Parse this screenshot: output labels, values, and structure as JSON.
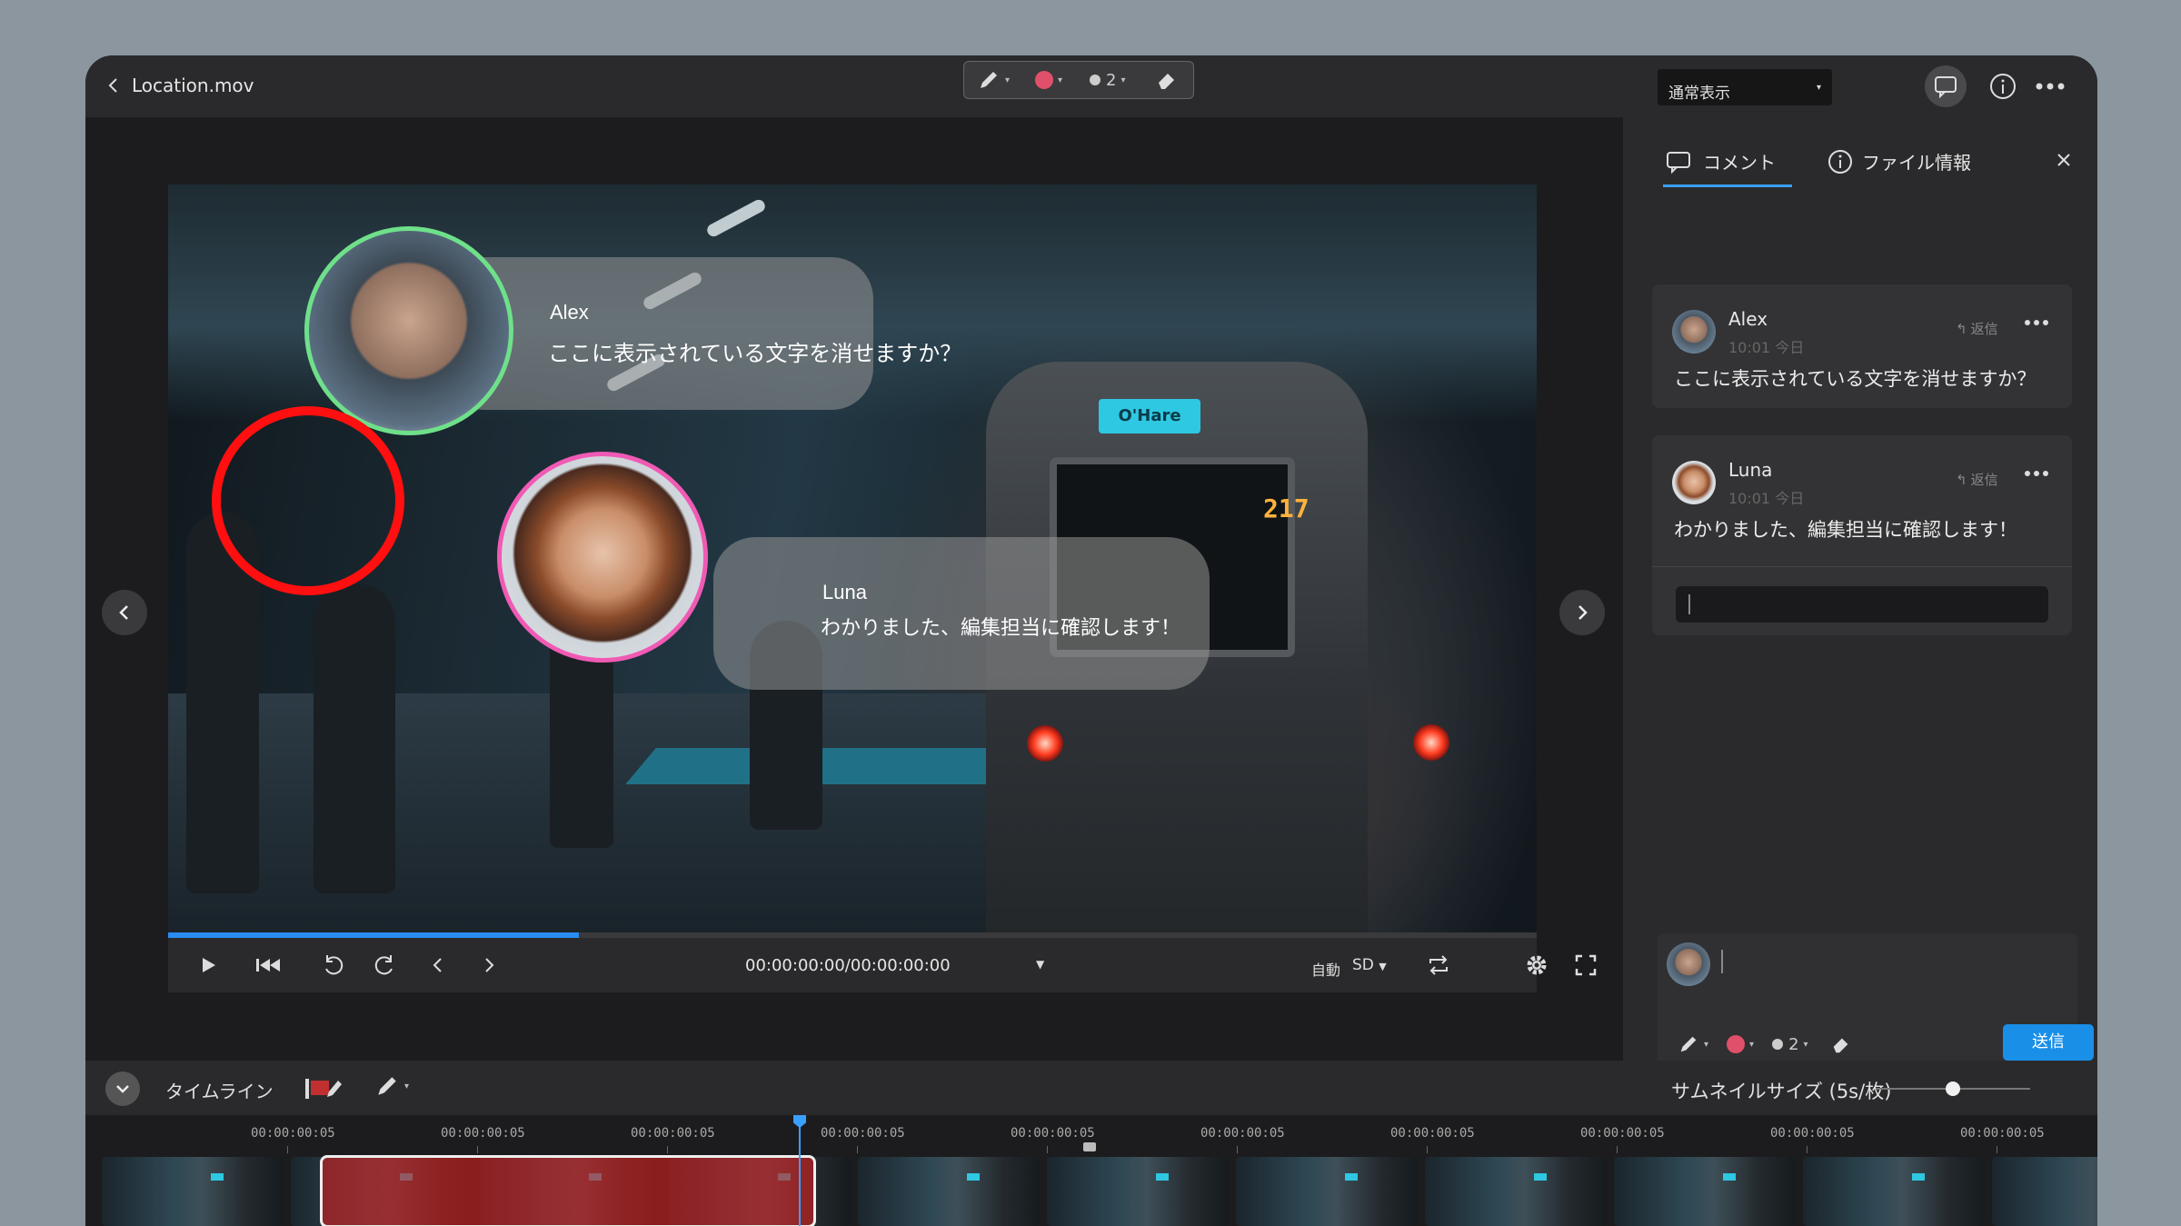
{
  "window": {
    "file_name": "Location.mov"
  },
  "draw_toolbar": {
    "pen_icon": "pen-icon",
    "color": "#e0506a",
    "stroke_size": "2",
    "eraser_icon": "eraser-icon"
  },
  "view_select": {
    "value": "通常表示"
  },
  "video": {
    "annotations": [
      {
        "name": "Alex",
        "text": "ここに表示されている文字を消せますか？",
        "ring_color": "#6fe08a"
      },
      {
        "name": "Luna",
        "text": "わかりました、編集担当に確認します！",
        "ring_color": "#f05ab4"
      }
    ],
    "train_sign": "O'Hare",
    "train_number": "217",
    "progress": 0.3,
    "timecode": "00:00:00:00/00:00:00:00",
    "quality_auto": "自動",
    "quality": "SD"
  },
  "panel": {
    "tab_comment": "コメント",
    "tab_info": "ファイル情報",
    "comments": [
      {
        "author": "Alex",
        "time": "10:01 今日",
        "reply": "返信",
        "text": "ここに表示されている文字を消せますか？"
      },
      {
        "author": "Luna",
        "time": "10:01 今日",
        "reply": "返信",
        "text": "わかりました、編集担当に確認します！"
      }
    ],
    "reply_placeholder": "",
    "composer": {
      "stroke_size": "2",
      "color": "#e0506a",
      "send_label": "送信"
    }
  },
  "timeline": {
    "label": "タイムライン",
    "thumbnail_size_label": "サムネイルサイズ (5s/枚)",
    "thumbnail_size_value": 0.5,
    "ticks": [
      "00:00:00:05",
      "00:00:00:05",
      "00:00:00:05",
      "00:00:00:05",
      "00:00:00:05",
      "00:00:00:05",
      "00:00:00:05",
      "00:00:00:05",
      "00:00:00:05",
      "00:00:00:05"
    ]
  }
}
